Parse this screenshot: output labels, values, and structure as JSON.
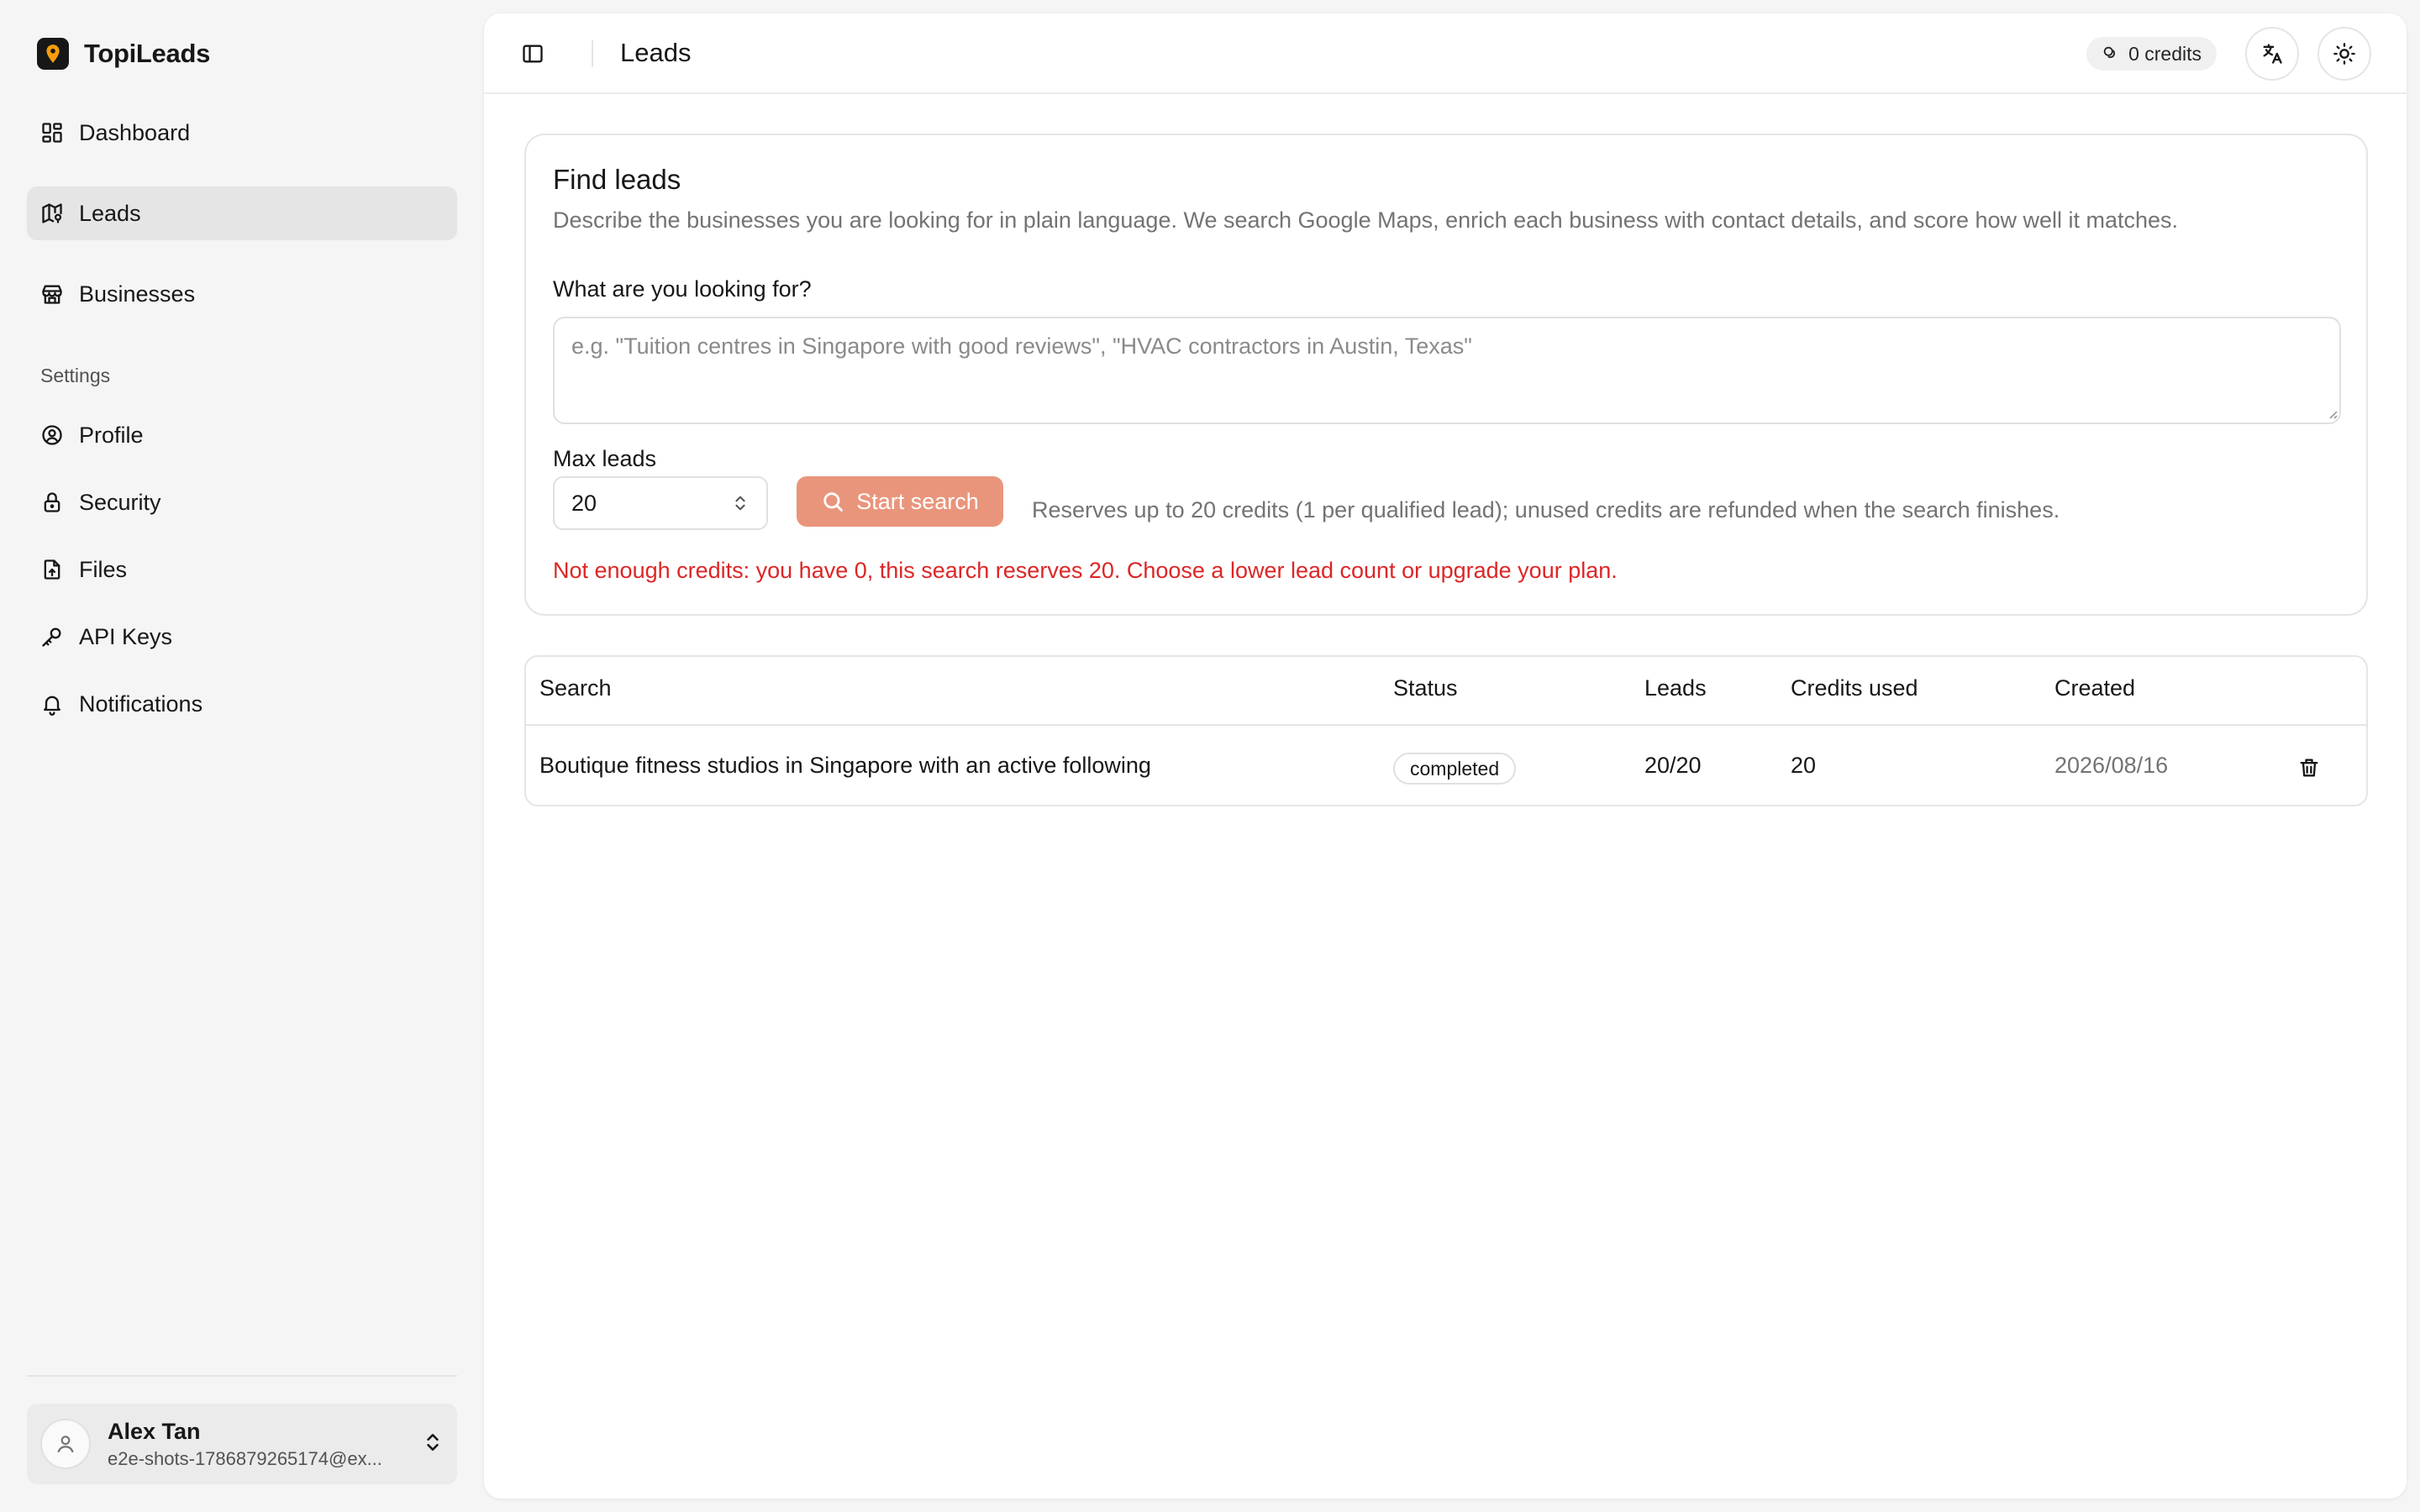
{
  "app": {
    "name": "TopiLeads",
    "accent_color": "#f59e0b",
    "button_color": "#e9957c",
    "error_color": "#dc2626"
  },
  "sidebar": {
    "items": [
      {
        "label": "Dashboard",
        "icon": "dashboard-icon",
        "active": false
      },
      {
        "label": "Leads",
        "icon": "map-icon",
        "active": true
      },
      {
        "label": "Businesses",
        "icon": "store-icon",
        "active": false
      }
    ],
    "settings_label": "Settings",
    "settings_items": [
      {
        "label": "Profile",
        "icon": "user-circle-icon"
      },
      {
        "label": "Security",
        "icon": "lock-icon"
      },
      {
        "label": "Files",
        "icon": "file-upload-icon"
      },
      {
        "label": "API Keys",
        "icon": "key-icon"
      },
      {
        "label": "Notifications",
        "icon": "bell-icon"
      }
    ],
    "user": {
      "name": "Alex Tan",
      "email": "e2e-shots-1786879265174@ex..."
    }
  },
  "header": {
    "title": "Leads",
    "credits": "0 credits"
  },
  "find_leads": {
    "title": "Find leads",
    "description": "Describe the businesses you are looking for in plain language. We search Google Maps, enrich each business with contact details, and score how well it matches.",
    "query_label": "What are you looking for?",
    "query_placeholder": "e.g. \"Tuition centres in Singapore with good reviews\", \"HVAC contractors in Austin, Texas\"",
    "max_label": "Max leads",
    "max_value": "20",
    "start_label": "Start search",
    "reserve_note": "Reserves up to 20 credits (1 per qualified lead); unused credits are refunded when the search finishes.",
    "error": "Not enough credits: you have 0, this search reserves 20. Choose a lower lead count or upgrade your plan."
  },
  "table": {
    "headers": [
      "Search",
      "Status",
      "Leads",
      "Credits used",
      "Created"
    ],
    "rows": [
      {
        "search": "Boutique fitness studios in Singapore with an active following",
        "status": "completed",
        "leads": "20/20",
        "credits": "20",
        "created": "2026/08/16"
      }
    ]
  }
}
